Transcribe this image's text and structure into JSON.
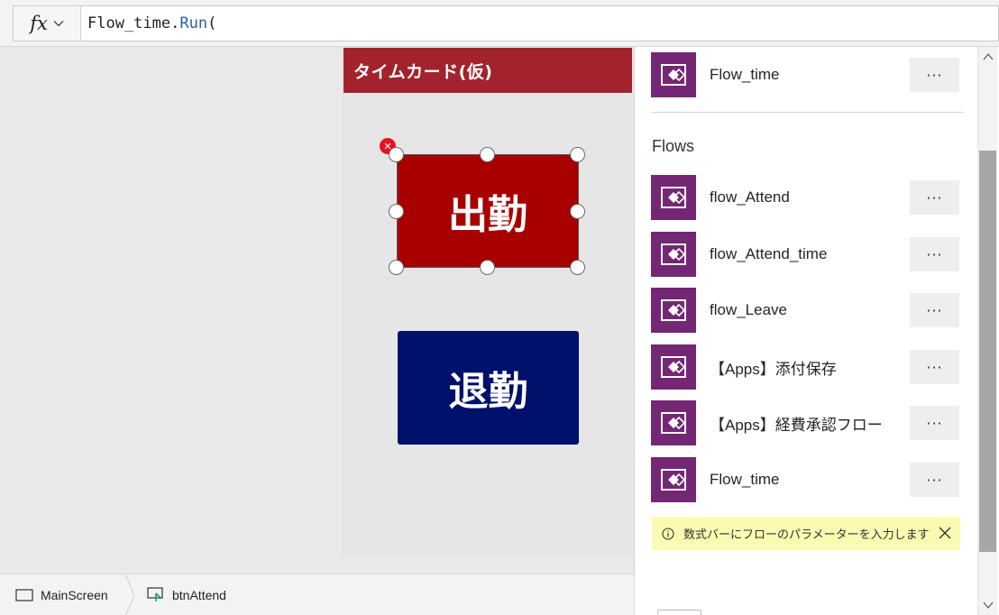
{
  "formula_bar": {
    "fx_label": "fx",
    "formula_object": "Flow_time.",
    "formula_function": "Run",
    "formula_rest": "("
  },
  "app": {
    "title": "タイムカード(仮)",
    "attend_button": "出勤",
    "leave_button": "退勤"
  },
  "breadcrumb": {
    "screen": "MainScreen",
    "control": "btnAttend"
  },
  "panel": {
    "top_flow": {
      "name": "Flow_time",
      "more": "···"
    },
    "section_heading": "Flows",
    "flows": [
      {
        "name": "flow_Attend",
        "more": "···"
      },
      {
        "name": "flow_Attend_time",
        "more": "···"
      },
      {
        "name": "flow_Leave",
        "more": "···"
      },
      {
        "name": "【Apps】添付保存",
        "more": "···"
      },
      {
        "name": "【Apps】経費承認フロー",
        "more": "···"
      },
      {
        "name": "Flow_time",
        "more": "···"
      }
    ],
    "info_banner": "数式バーにフローのパラメーターを入力します"
  },
  "colors": {
    "title_bar": "#a2232c",
    "attend": "#a80000",
    "leave": "#00116b",
    "flow_icon": "#742774",
    "banner": "#fafab2"
  },
  "icons": {
    "fx": "fx-icon",
    "flow": "power-automate-flow-icon",
    "info": "info-icon",
    "close": "close-icon",
    "screen": "screen-icon",
    "button_control": "button-control-icon"
  }
}
